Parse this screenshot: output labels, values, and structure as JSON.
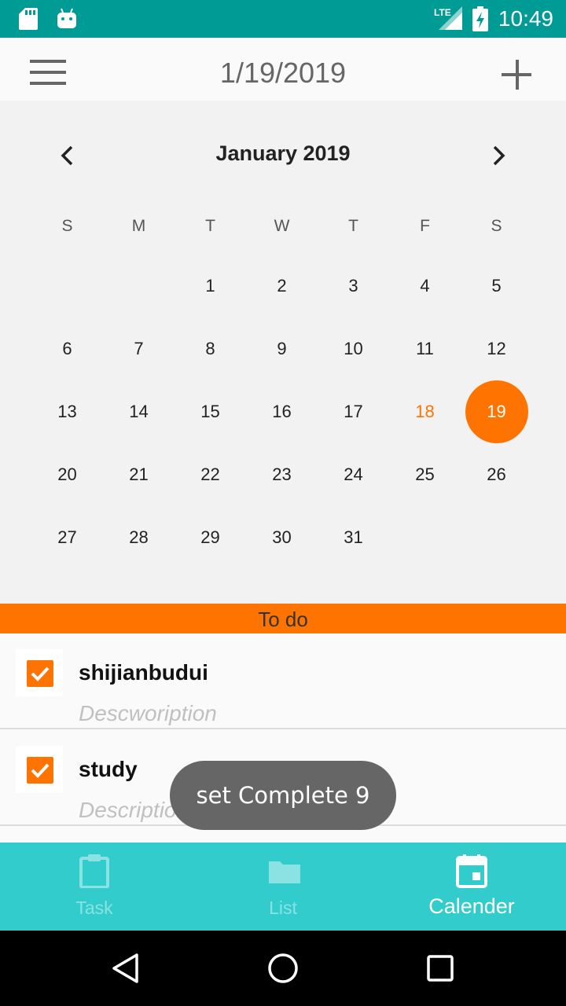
{
  "status_bar": {
    "time": "10:49",
    "network": "LTE",
    "icons": [
      "sd-card-icon",
      "android-icon",
      "signal-icon",
      "battery-charging-icon"
    ]
  },
  "app_bar": {
    "title": "1/19/2019",
    "menu_icon": "hamburger-menu-icon",
    "add_icon": "plus-icon"
  },
  "calendar": {
    "month_title": "January 2019",
    "weekdays": [
      "S",
      "M",
      "T",
      "W",
      "T",
      "F",
      "S"
    ],
    "days": [
      "",
      "",
      "1",
      "2",
      "3",
      "4",
      "5",
      "6",
      "7",
      "8",
      "9",
      "10",
      "11",
      "12",
      "13",
      "14",
      "15",
      "16",
      "17",
      "18",
      "19",
      "20",
      "21",
      "22",
      "23",
      "24",
      "25",
      "26",
      "27",
      "28",
      "29",
      "30",
      "31",
      "",
      ""
    ],
    "today": "18",
    "selected": "19",
    "accent_color": "#ff7400"
  },
  "todo": {
    "header": "To do",
    "tasks": [
      {
        "name": "shijianbudui",
        "description": "Descwoription",
        "checked": true
      },
      {
        "name": "study",
        "description": "Description",
        "checked": true
      }
    ]
  },
  "toast": {
    "message": "set Complete 9"
  },
  "bottom_nav": {
    "items": [
      {
        "label": "Task",
        "icon": "clipboard-icon",
        "active": false
      },
      {
        "label": "List",
        "icon": "folder-icon",
        "active": false
      },
      {
        "label": "Calender",
        "icon": "calendar-icon",
        "active": true
      }
    ],
    "background": "#32cccc"
  },
  "system_nav": {
    "icons": [
      "back-icon",
      "home-icon",
      "recents-icon"
    ]
  }
}
